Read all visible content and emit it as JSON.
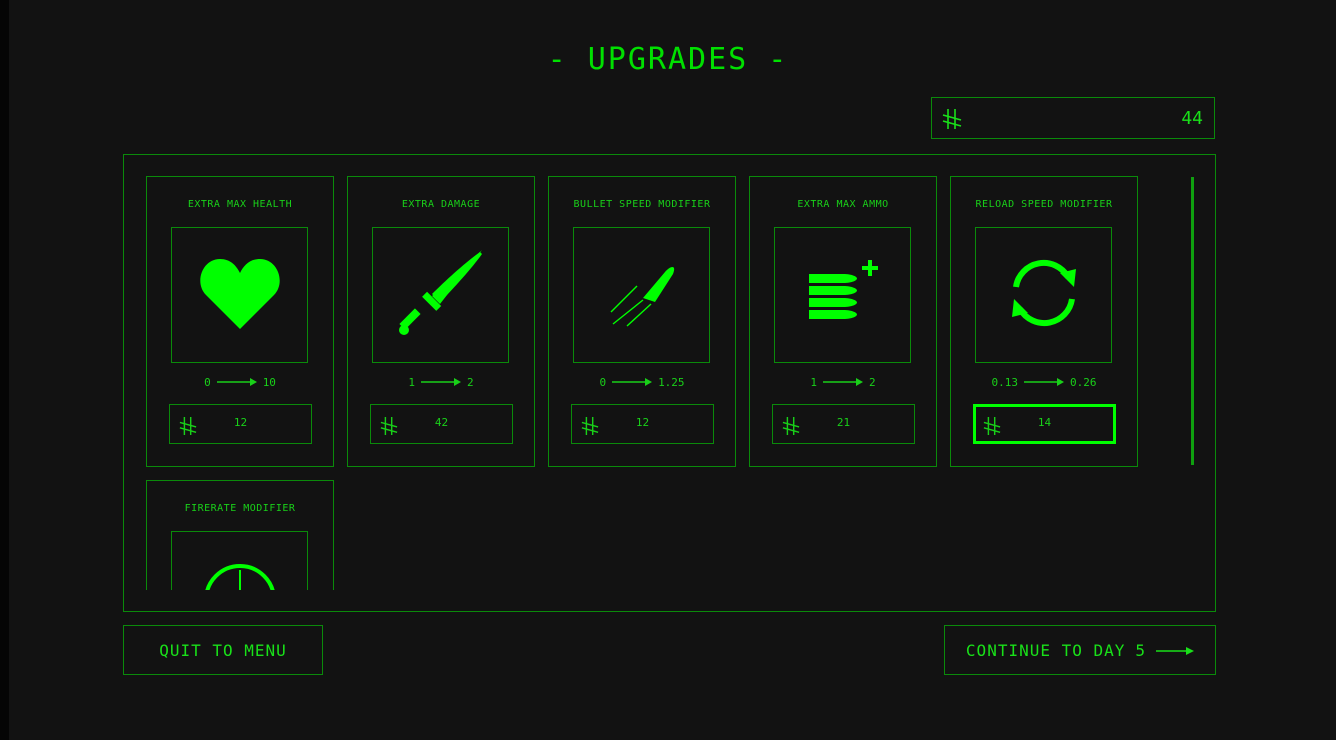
{
  "title": "- UPGRADES -",
  "currency_icon": "currency-glyph-icon",
  "balance": "44",
  "colors": {
    "background": "#121212",
    "accent": "#00e000",
    "border": "#0a8a0a",
    "selected": "#00ff00"
  },
  "upgrades": [
    {
      "name": "EXTRA MAX HEALTH",
      "icon": "heart-icon",
      "from": "0",
      "to": "10",
      "price": "12"
    },
    {
      "name": "EXTRA DAMAGE",
      "icon": "sword-icon",
      "from": "1",
      "to": "2",
      "price": "42"
    },
    {
      "name": "BULLET SPEED MODIFIER",
      "icon": "bullet-icon",
      "from": "0",
      "to": "1.25",
      "price": "12"
    },
    {
      "name": "EXTRA MAX AMMO",
      "icon": "ammo-plus-icon",
      "from": "1",
      "to": "2",
      "price": "21"
    },
    {
      "name": "RELOAD SPEED MODIFIER",
      "icon": "reload-icon",
      "from": "0.13",
      "to": "0.26",
      "price": "14"
    },
    {
      "name": "FIRERATE MODIFIER",
      "icon": "gauge-icon"
    }
  ],
  "buttons": {
    "quit": "QUIT TO MENU",
    "continue": "CONTINUE TO DAY",
    "continue_day": "5"
  }
}
